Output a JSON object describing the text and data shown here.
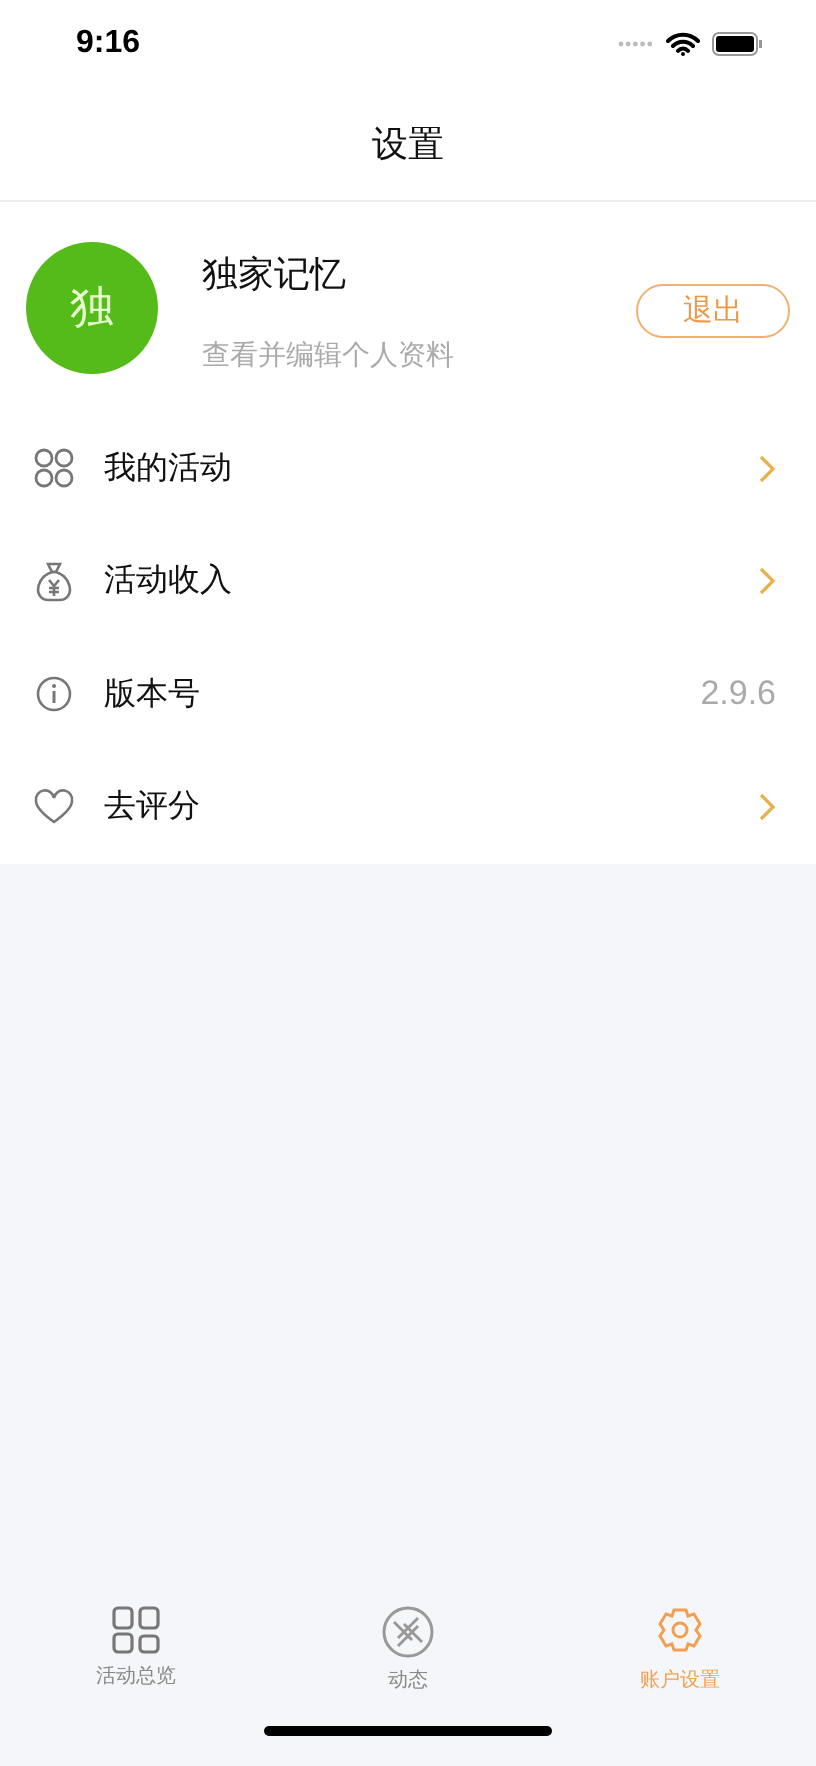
{
  "status_bar": {
    "time": "9:16"
  },
  "nav": {
    "title": "设置"
  },
  "profile": {
    "avatar": "独",
    "name": "独家记忆",
    "subtitle": "查看并编辑个人资料",
    "logout": "退出"
  },
  "rows": [
    {
      "label": "我的活动",
      "kind": "link"
    },
    {
      "label": "活动收入",
      "kind": "link"
    },
    {
      "label": "版本号",
      "kind": "value",
      "value": "2.9.6"
    },
    {
      "label": "去评分",
      "kind": "link"
    }
  ],
  "tabs": [
    {
      "label": "活动总览",
      "selected": false
    },
    {
      "label": "动态",
      "selected": false
    },
    {
      "label": "账户设置",
      "selected": true
    }
  ]
}
